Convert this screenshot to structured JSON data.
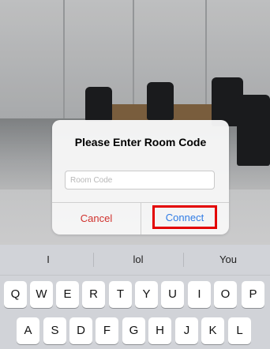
{
  "dialog": {
    "title": "Please Enter Room Code",
    "input_placeholder": "Room Code",
    "input_value": "",
    "cancel_label": "Cancel",
    "connect_label": "Connect"
  },
  "keyboard": {
    "suggestions": [
      "I",
      "lol",
      "You"
    ],
    "row1": [
      "Q",
      "W",
      "E",
      "R",
      "T",
      "Y",
      "U",
      "I",
      "O",
      "P"
    ],
    "row2": [
      "A",
      "S",
      "D",
      "F",
      "G",
      "H",
      "J",
      "K",
      "L"
    ]
  },
  "colors": {
    "cancel": "#d0312d",
    "connect": "#2f7be5",
    "highlight": "#e30000"
  }
}
